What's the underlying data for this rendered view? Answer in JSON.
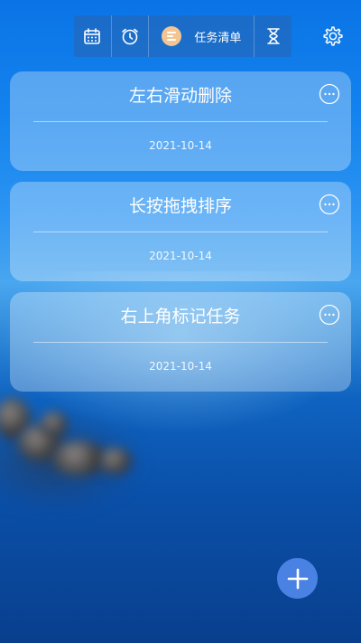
{
  "topbar": {
    "list_label": "任务清单",
    "icons": [
      "calendar-icon",
      "alarm-clock-icon",
      "list-avatar-icon",
      "hourglass-icon"
    ]
  },
  "settings_icon": "gear-icon",
  "tasks": [
    {
      "title": "左右滑动删除",
      "date": "2021-10-14"
    },
    {
      "title": "长按拖拽排序",
      "date": "2021-10-14"
    },
    {
      "title": "右上角标记任务",
      "date": "2021-10-14"
    }
  ],
  "fab_icon": "plus-icon",
  "colors": {
    "card_bg": "rgba(255,255,255,0.30)",
    "fab": "#4a82e3",
    "avatar": "#f2c592"
  }
}
